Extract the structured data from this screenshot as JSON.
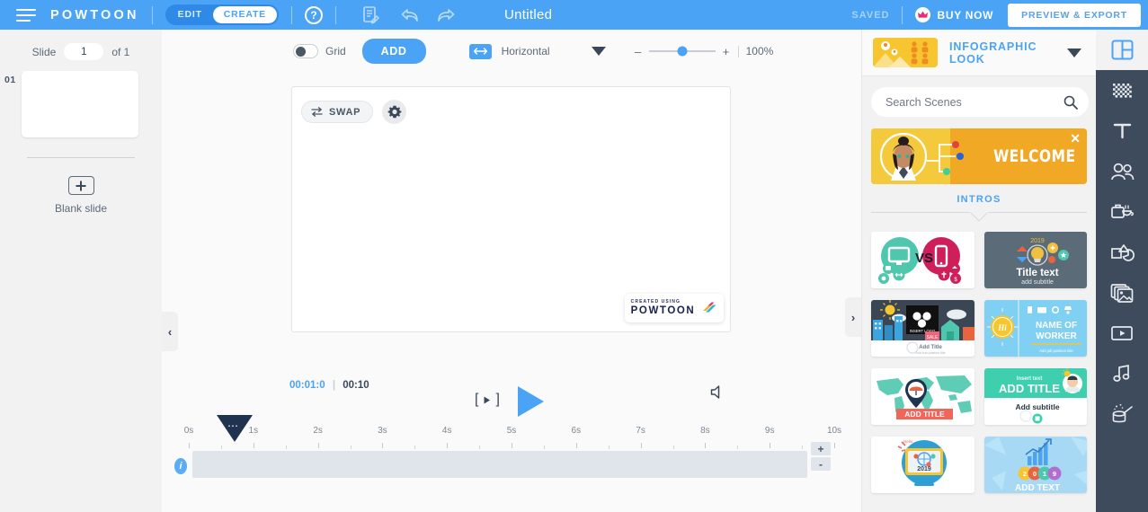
{
  "header": {
    "menu_icon": "hamburger-icon",
    "logo": "POWTOON",
    "mode_tabs": [
      {
        "label": "EDIT",
        "active": false
      },
      {
        "label": "CREATE",
        "active": true
      }
    ],
    "help_icon": "question-mark-icon",
    "notes_icon": "document-edit-icon",
    "undo_icon": "undo-arrow-icon",
    "redo_icon": "redo-arrow-icon",
    "document_title": "Untitled",
    "saved_status": "SAVED",
    "buy_now_label": "BUY NOW",
    "buy_now_icon": "crown-icon",
    "preview_export_label": "PREVIEW & EXPORT",
    "accent_blue": "#4aa3f5",
    "header_blue": "#4aa3f5",
    "crown_pink": "#ec297b"
  },
  "slides_panel": {
    "slide_word": "Slide",
    "current_slide": "1",
    "of_text": "of 1",
    "slides": [
      {
        "index": "01"
      }
    ],
    "blank_slide_label": "Blank slide",
    "add_icon": "plus-icon"
  },
  "toolbar": {
    "grid_label": "Grid",
    "grid_enabled": false,
    "add_label": "ADD",
    "orientation_icon": "horizontal-arrows-icon",
    "orientation_label": "Horizontal",
    "dropdown_icon": "chevron-down-icon",
    "zoom_minus": "–",
    "zoom_plus": "+",
    "zoom_value": "100%",
    "aspect_ratio": "(16:9)"
  },
  "canvas": {
    "swap_label": "SWAP",
    "swap_icon": "swap-arrows-icon",
    "settings_icon": "gear-icon",
    "watermark_top": "CREATED USING",
    "watermark_bottom": "POWTOON",
    "nav_prev_icon": "chevron-left-icon",
    "nav_next_icon": "chevron-right-icon"
  },
  "playback": {
    "current_time": "00:01:0",
    "separator": "|",
    "total_time": "00:10",
    "step_icon": "step-frame-icon",
    "step_bracket_left": "[",
    "step_bracket_right": "]",
    "play_icon": "play-triangle-icon",
    "sound_icon": "speaker-mute-icon"
  },
  "timeline": {
    "ticks": [
      "0s",
      "1s",
      "2s",
      "3s",
      "4s",
      "5s",
      "6s",
      "7s",
      "8s",
      "9s",
      "10s"
    ],
    "info_icon": "info-icon",
    "info_label": "i",
    "playhead_position_seconds": 1,
    "playhead_icon": "playhead-handle-icon",
    "zoom_in_label": "+",
    "zoom_out_label": "-",
    "track_color": "#dfe5eb"
  },
  "library": {
    "title": "INFOGRAPHIC LOOK",
    "thumb_icon": "infographic-look-thumbnail",
    "caret_icon": "chevron-down-icon",
    "search_placeholder": "Search Scenes",
    "search_value": "",
    "search_icon": "magnifier-icon",
    "promo": {
      "text": "WELCOME",
      "close_icon": "close-x-icon",
      "bg_color": "#f4c93c",
      "bg_color_2": "#f0a825"
    },
    "category_label": "INTROS",
    "scenes": [
      {
        "name": "vs-desktop-mobile-scene",
        "caption": "VS"
      },
      {
        "name": "title-text-2019-scene",
        "caption": "Title text"
      },
      {
        "name": "insert-logo-city-scene",
        "caption": "Add Title"
      },
      {
        "name": "name-of-worker-scene",
        "caption": "NAME OF WORKER"
      },
      {
        "name": "world-map-add-title-scene",
        "caption": "ADD TITLE"
      },
      {
        "name": "add-title-subtitle-scene",
        "caption": "ADD TITLE"
      },
      {
        "name": "2019-monitor-scene",
        "caption": "2019"
      },
      {
        "name": "2019-chart-add-text-scene",
        "caption": "ADD TEXT"
      }
    ]
  },
  "rail": {
    "items": [
      {
        "name": "scenes-icon",
        "active": true
      },
      {
        "name": "background-icon",
        "active": false
      },
      {
        "name": "text-icon",
        "active": false
      },
      {
        "name": "characters-icon",
        "active": false
      },
      {
        "name": "props-icon",
        "active": false
      },
      {
        "name": "shapes-icon",
        "active": false
      },
      {
        "name": "images-icon",
        "active": false
      },
      {
        "name": "video-icon",
        "active": false
      },
      {
        "name": "music-icon",
        "active": false
      },
      {
        "name": "effects-icon",
        "active": false
      }
    ],
    "bg_color": "#3e4b5c"
  }
}
